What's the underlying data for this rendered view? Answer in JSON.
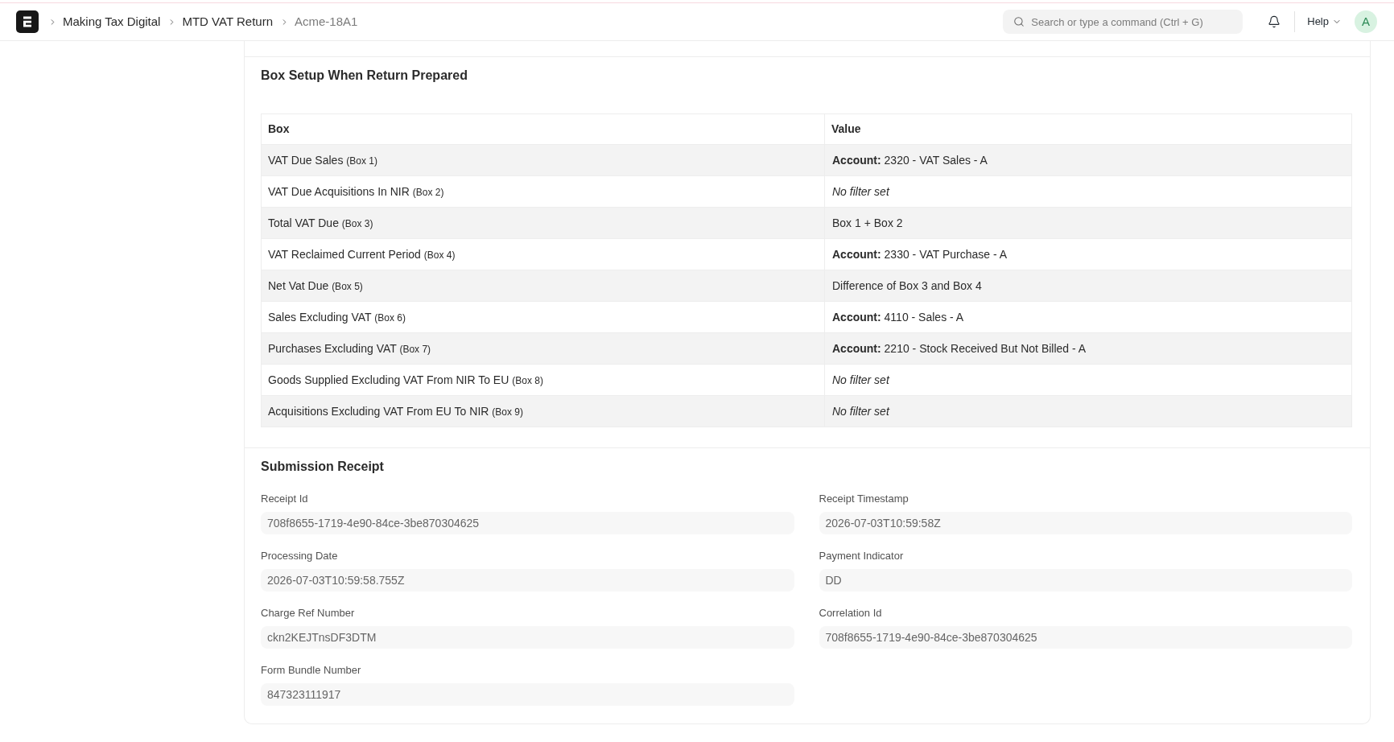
{
  "navbar": {
    "breadcrumbs": [
      {
        "label": "Making Tax Digital",
        "current": false
      },
      {
        "label": "MTD VAT Return",
        "current": false
      },
      {
        "label": "Acme-18A1",
        "current": true
      }
    ],
    "search": {
      "placeholder": "Search or type a command (Ctrl + G)"
    },
    "help": "Help",
    "avatar": "A"
  },
  "box_setup": {
    "title": "Box Setup When Return Prepared",
    "table": {
      "columns": [
        "Box",
        "Value"
      ],
      "rows": [
        {
          "box": "VAT Due Sales",
          "box_ref": "(Box 1)",
          "value": "**Account:** 2320 - VAT Sales - A",
          "kind": "account"
        },
        {
          "box": "VAT Due Acquisitions In NIR",
          "box_ref": "(Box 2)",
          "value": "No filter set",
          "kind": "none"
        },
        {
          "box": "Total VAT Due",
          "box_ref": "(Box 3)",
          "value": "Box 1 + Box 2",
          "kind": "formula"
        },
        {
          "box": "VAT Reclaimed Current Period",
          "box_ref": "(Box 4)",
          "value": "**Account:** 2330 - VAT Purchase - A",
          "kind": "account"
        },
        {
          "box": "Net Vat Due",
          "box_ref": "(Box 5)",
          "value": "Difference of Box 3 and Box 4",
          "kind": "formula"
        },
        {
          "box": "Sales Excluding VAT",
          "box_ref": "(Box 6)",
          "value": "**Account:** 4110 - Sales - A",
          "kind": "account"
        },
        {
          "box": "Purchases Excluding VAT",
          "box_ref": "(Box 7)",
          "value": "**Account:** 2210 - Stock Received But Not Billed - A",
          "kind": "account"
        },
        {
          "box": "Goods Supplied Excluding VAT From NIR To EU",
          "box_ref": "(Box 8)",
          "value": "No filter set",
          "kind": "none"
        },
        {
          "box": "Acquisitions Excluding VAT From EU To NIR",
          "box_ref": "(Box 9)",
          "value": "No filter set",
          "kind": "none"
        }
      ]
    }
  },
  "submission_receipt": {
    "title": "Submission Receipt",
    "columns": [
      {
        "fields": [
          {
            "label": "Receipt Id",
            "value": "708f8655-1719-4e90-84ce-3be870304625"
          },
          {
            "label": "Processing Date",
            "value": "2026-07-03T10:59:58.755Z"
          },
          {
            "label": "Charge Ref Number",
            "value": "ckn2KEJTnsDF3DTM"
          },
          {
            "label": "Form Bundle Number",
            "value": "847323111917"
          }
        ]
      },
      {
        "fields": [
          {
            "label": "Receipt Timestamp",
            "value": "2026-07-03T10:59:58Z"
          },
          {
            "label": "Payment Indicator",
            "value": "DD"
          },
          {
            "label": "Correlation Id",
            "value": "708f8655-1719-4e90-84ce-3be870304625"
          }
        ]
      }
    ]
  }
}
